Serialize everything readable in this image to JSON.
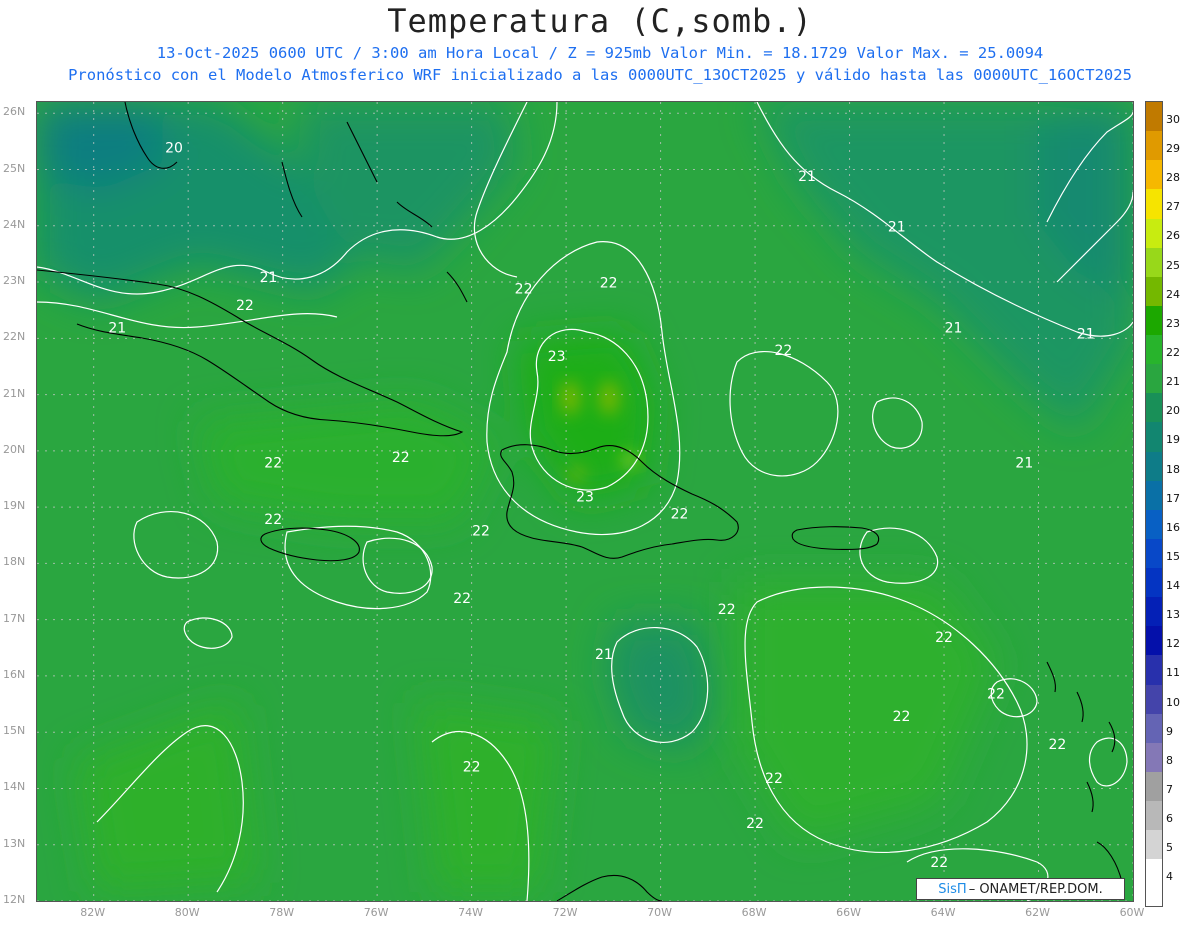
{
  "header": {
    "title": "Temperatura (C,somb.)",
    "line1": "13-Oct-2025  0600 UTC / 3:00 am Hora Local / Z = 925mb    Valor Min. = 18.1729  Valor Max. = 25.0094",
    "line2": "Pronóstico con el Modelo Atmosferico WRF inicializado a las 0000UTC_13OCT2025 y válido hasta las  0000UTC_16OCT2025"
  },
  "map": {
    "lat_labels": [
      "26N",
      "25N",
      "24N",
      "23N",
      "22N",
      "21N",
      "20N",
      "19N",
      "18N",
      "17N",
      "16N",
      "15N",
      "14N",
      "13N",
      "12N"
    ],
    "lon_labels": [
      "82W",
      "80W",
      "78W",
      "76W",
      "74W",
      "72W",
      "70W",
      "68W",
      "66W",
      "64W",
      "62W",
      "60W"
    ],
    "contour_labels": [
      {
        "text": "20",
        "lon": -80.3,
        "lat": 25.3
      },
      {
        "text": "21",
        "lon": -78.3,
        "lat": 23.0
      },
      {
        "text": "21",
        "lon": -81.5,
        "lat": 22.1
      },
      {
        "text": "22",
        "lon": -78.8,
        "lat": 22.5
      },
      {
        "text": "22",
        "lon": -72.9,
        "lat": 22.8
      },
      {
        "text": "22",
        "lon": -71.1,
        "lat": 22.9
      },
      {
        "text": "23",
        "lon": -72.2,
        "lat": 21.6
      },
      {
        "text": "22",
        "lon": -75.5,
        "lat": 19.8
      },
      {
        "text": "22",
        "lon": -78.2,
        "lat": 19.7
      },
      {
        "text": "23",
        "lon": -71.6,
        "lat": 19.1
      },
      {
        "text": "22",
        "lon": -69.6,
        "lat": 18.8
      },
      {
        "text": "22",
        "lon": -78.2,
        "lat": 18.7
      },
      {
        "text": "22",
        "lon": -73.8,
        "lat": 18.5
      },
      {
        "text": "22",
        "lon": -74.2,
        "lat": 17.3
      },
      {
        "text": "22",
        "lon": -68.6,
        "lat": 17.1
      },
      {
        "text": "22",
        "lon": -64.0,
        "lat": 16.6
      },
      {
        "text": "22",
        "lon": -62.9,
        "lat": 15.6
      },
      {
        "text": "22",
        "lon": -64.9,
        "lat": 15.2
      },
      {
        "text": "21",
        "lon": -71.2,
        "lat": 16.3
      },
      {
        "text": "22",
        "lon": -74.0,
        "lat": 14.3
      },
      {
        "text": "22",
        "lon": -67.6,
        "lat": 14.1
      },
      {
        "text": "22",
        "lon": -68.0,
        "lat": 13.3
      },
      {
        "text": "22",
        "lon": -64.1,
        "lat": 12.6
      },
      {
        "text": "22",
        "lon": -61.6,
        "lat": 14.7
      },
      {
        "text": "21",
        "lon": -66.9,
        "lat": 24.8
      },
      {
        "text": "21",
        "lon": -65.0,
        "lat": 23.9
      },
      {
        "text": "21",
        "lon": -63.8,
        "lat": 22.1
      },
      {
        "text": "22",
        "lon": -67.4,
        "lat": 21.7
      },
      {
        "text": "21",
        "lon": -61.0,
        "lat": 22.0
      },
      {
        "text": "21",
        "lon": -62.3,
        "lat": 19.7
      }
    ]
  },
  "colorbar": {
    "labels": [
      "30",
      "29",
      "28",
      "27",
      "26",
      "25",
      "24",
      "23",
      "22",
      "21",
      "20",
      "19",
      "18",
      "17",
      "16",
      "15",
      "14",
      "13",
      "12",
      "11",
      "10",
      "9",
      "8",
      "7",
      "6",
      "5",
      "4"
    ],
    "colors": [
      "#c07a00",
      "#e09a00",
      "#f6b800",
      "#f6e400",
      "#c8ec10",
      "#98d81a",
      "#74b800",
      "#1ca800",
      "#28b42c",
      "#2aa640",
      "#199058",
      "#128670",
      "#0e7c88",
      "#0a70a6",
      "#0860c4",
      "#0848c8",
      "#0434c2",
      "#0420b6",
      "#0410aa",
      "#2830ac",
      "#4444aa",
      "#6464b4",
      "#8478b6",
      "#a0a0a0",
      "#b8b8b8",
      "#d4d4d4",
      "#ffffff"
    ]
  },
  "credit": {
    "sis": "SisΠ",
    "org": "– ONAMET/REP.DOM."
  },
  "colors": {
    "sub_text": "#1e6ff0",
    "field_base": "#2aa640",
    "contour": "#ffffff",
    "coast": "#000000"
  }
}
